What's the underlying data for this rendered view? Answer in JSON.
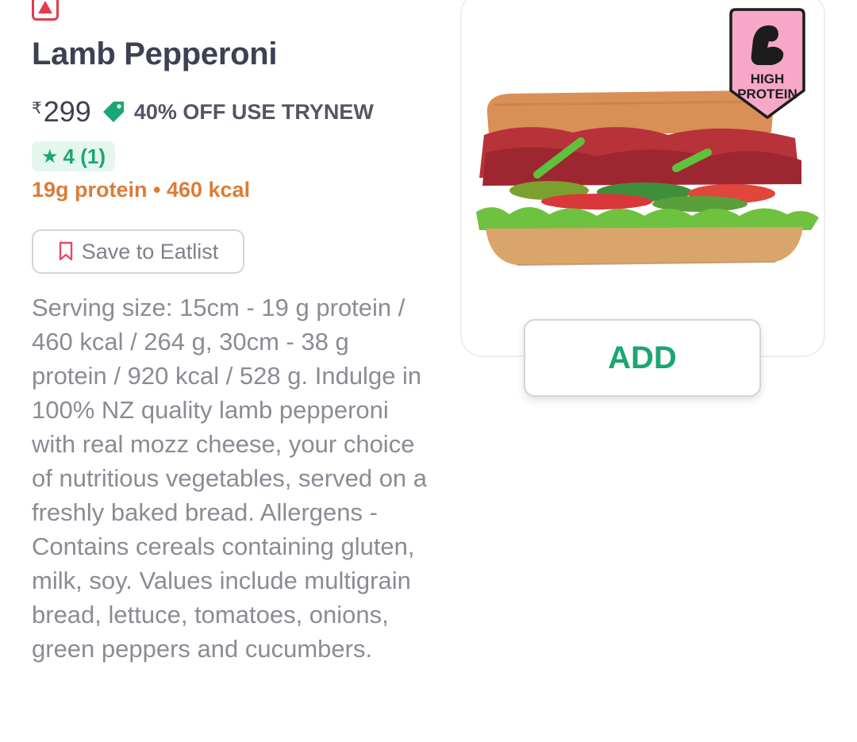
{
  "item": {
    "title": "Lamb Pepperoni",
    "currency_symbol": "₹",
    "price": "299",
    "offer": "40% OFF USE TRYNEW",
    "rating_text": "4 (1)",
    "nutrition": "19g protein • 460 kcal",
    "save_label": "Save to Eatlist",
    "description": "Serving size: 15cm - 19 g protein / 460 kcal / 264 g, 30cm - 38 g protein / 920 kcal / 528 g. Indulge in 100% NZ quality lamb pepperoni with real mozz cheese, your choice of nutritious vegetables, served on a freshly baked bread. Allergens - Contains cereals containing gluten, milk, soy. Values include multigrain bread, lettuce, tomatoes, onions, green peppers and cucumbers.",
    "badge_line1": "HIGH",
    "badge_line2": "PROTEIN",
    "add_label": "ADD"
  },
  "icons": {
    "food_type": "non-veg-triangle-icon",
    "offer": "offer-tag-icon",
    "rating": "star-icon",
    "save": "bookmark-icon",
    "badge": "flexed-bicep-icon"
  },
  "colors": {
    "accent_green": "#1ba672",
    "nonveg_red": "#e43b4f",
    "nutrition_orange": "#db7c38",
    "badge_pink": "#f7a8c8"
  }
}
